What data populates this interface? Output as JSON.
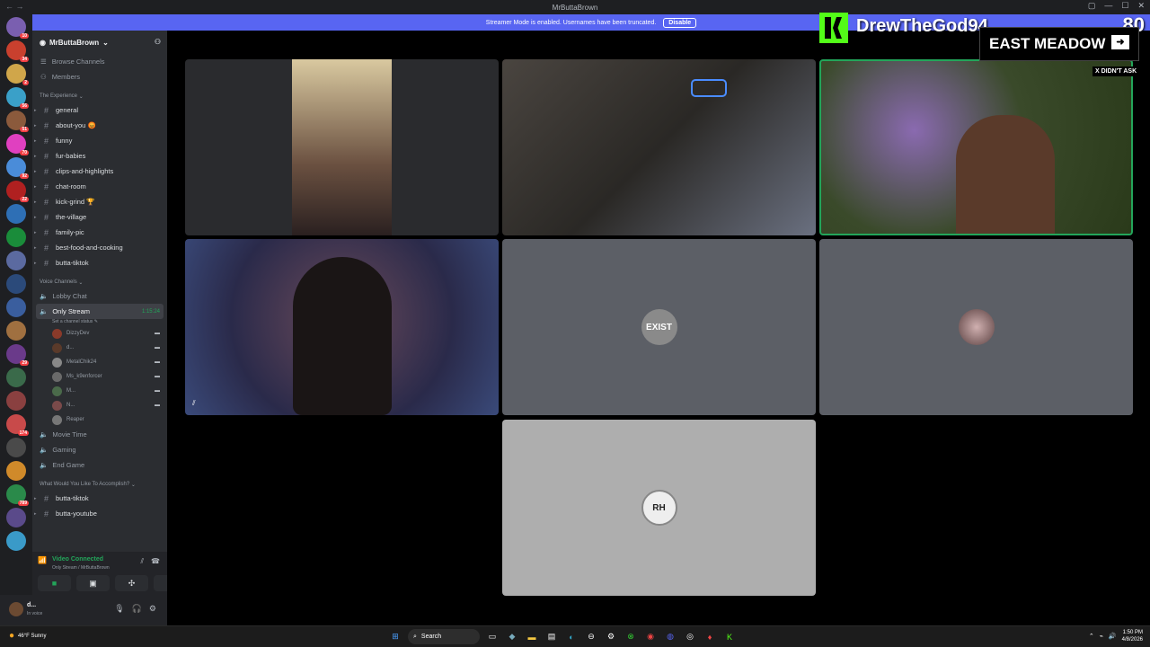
{
  "window": {
    "title": "MrButtaBrown"
  },
  "streamer_banner": {
    "text": "Streamer Mode is enabled. Usernames have been truncated.",
    "disable_label": "Disable"
  },
  "servers": [
    {
      "color": "#7a5fb0",
      "badge": "10"
    },
    {
      "color": "#c9402e",
      "badge": "34"
    },
    {
      "color": "#d0a64a",
      "badge": "2"
    },
    {
      "color": "#3aa0c8",
      "badge": "56"
    },
    {
      "color": "#8b5a3c",
      "badge": "51"
    },
    {
      "color": "#e040c0",
      "badge": "70"
    },
    {
      "color": "#4a8cd9",
      "badge": "92"
    },
    {
      "color": "#b02020",
      "badge": "22"
    },
    {
      "color": "#2e6fb5",
      "badge": ""
    },
    {
      "color": "#1a8c3a",
      "badge": ""
    },
    {
      "color": "#5b6aa0",
      "badge": ""
    },
    {
      "color": "#2b4a7a",
      "badge": ""
    },
    {
      "color": "#3a5e9e",
      "badge": ""
    },
    {
      "color": "#a07040",
      "badge": ""
    },
    {
      "color": "#6a3a8a",
      "badge": "29"
    },
    {
      "color": "#3a6a4a",
      "badge": ""
    },
    {
      "color": "#8a4040",
      "badge": ""
    },
    {
      "color": "#c84a4a",
      "badge": "174"
    },
    {
      "color": "#4a4a4a",
      "badge": ""
    },
    {
      "color": "#d08a2a",
      "badge": ""
    },
    {
      "color": "#2a8a4a",
      "badge": "789"
    },
    {
      "color": "#5a4a8a",
      "badge": ""
    },
    {
      "color": "#3a9ac8",
      "badge": ""
    }
  ],
  "sidebar": {
    "server_name": "MrButtaBrown",
    "menu": [
      "Browse Channels",
      "Members"
    ],
    "category1": "The Experience",
    "text_channels": [
      "general",
      "about-you 😡",
      "funny",
      "fur-babies",
      "clips-and-highlights",
      "chat-room",
      "kick-grind 🏆",
      "the-village",
      "family-pic",
      "best-food-and-cooking",
      "butta-tiktok"
    ],
    "category2": "Voice Channels",
    "voice_lobby": "Lobby Chat",
    "voice_active": {
      "name": "Only Stream",
      "timer": "1:15:24",
      "status": "Set a channel status ✎"
    },
    "members": [
      {
        "name": "DizzyDev",
        "color": "#8a3a2a"
      },
      {
        "name": "d...",
        "color": "#5a3a2a"
      },
      {
        "name": "MetalChik24",
        "color": "#888888"
      },
      {
        "name": "Ms_k9enforcer",
        "color": "#6a6a6a"
      },
      {
        "name": "M...",
        "color": "#4a6a4a"
      },
      {
        "name": "N...",
        "color": "#7a4a4a"
      },
      {
        "name": "Reaper",
        "color": "#777777"
      }
    ],
    "voice_more": [
      "Movie Time",
      "Gaming",
      "End Game"
    ],
    "category3": "What Would You Like To Accomplish?",
    "text_channels2": [
      "butta-tiktok",
      "butta-youtube"
    ]
  },
  "voice_panel": {
    "status": "Video Connected",
    "sub": "Only Stream / MrButtaBrown"
  },
  "user_panel": {
    "weather": "46°F Sunny",
    "name": "d...",
    "status": "In voice"
  },
  "overlay": {
    "kick_name": "DrewTheGod94",
    "count": "80",
    "meadow": "EAST MEADOW",
    "tag": "X DIDN'T ASK"
  },
  "tiles": [
    {
      "name": "tile-phone-user",
      "bg": "#2a2b2e"
    },
    {
      "name": "tile-gym-room",
      "bg": "#3a3530"
    },
    {
      "name": "tile-drewthegod",
      "bg": "#3a4a2a"
    },
    {
      "name": "tile-makeup-user",
      "bg": "#2a2a4a"
    },
    {
      "name": "tile-exist-user",
      "bg": "#5c5f66",
      "avatar": "EXIST"
    },
    {
      "name": "tile-avatar-user",
      "bg": "#5c5f66",
      "avatar": ""
    },
    {
      "name": "tile-rh-user",
      "bg": "#aeaeae",
      "avatar": "RH"
    }
  ],
  "taskbar": {
    "weather": "46°F\nSunny",
    "search": "Search",
    "time": "1:50 PM",
    "date": "4/8/2026"
  }
}
